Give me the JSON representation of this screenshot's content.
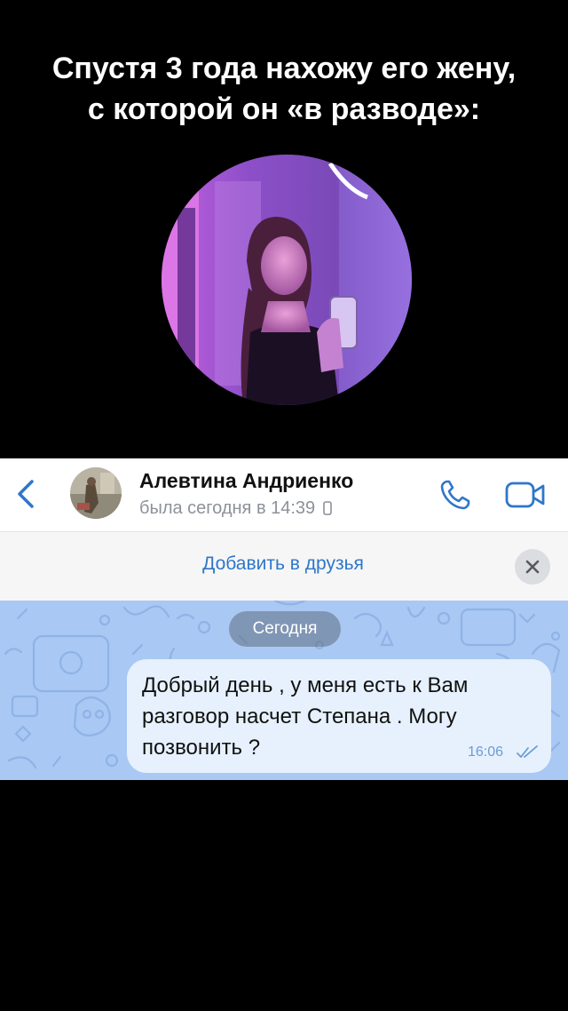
{
  "caption": {
    "line1": "Спустя 3 года нахожу его жену,",
    "line2": "с которой он «в разводе»:"
  },
  "header": {
    "contact_name": "Алевтина Андриенко",
    "status": "была сегодня в 14:39"
  },
  "banner": {
    "add_friend": "Добавить в друзья"
  },
  "chat": {
    "date_label": "Сегодня",
    "message": {
      "text": "Добрый день , у меня есть к  Вам\nразговор насчет Степана . Могу\nпозвонить ?",
      "time": "16:06"
    }
  },
  "colors": {
    "accent": "#2f76c9",
    "chat_background": "#a9c8f3",
    "bubble": "#e6f1fd"
  },
  "icons": [
    "back-chevron-icon",
    "phone-icon",
    "video-call-icon",
    "close-icon",
    "double-check-icon",
    "mobile-device-icon"
  ]
}
